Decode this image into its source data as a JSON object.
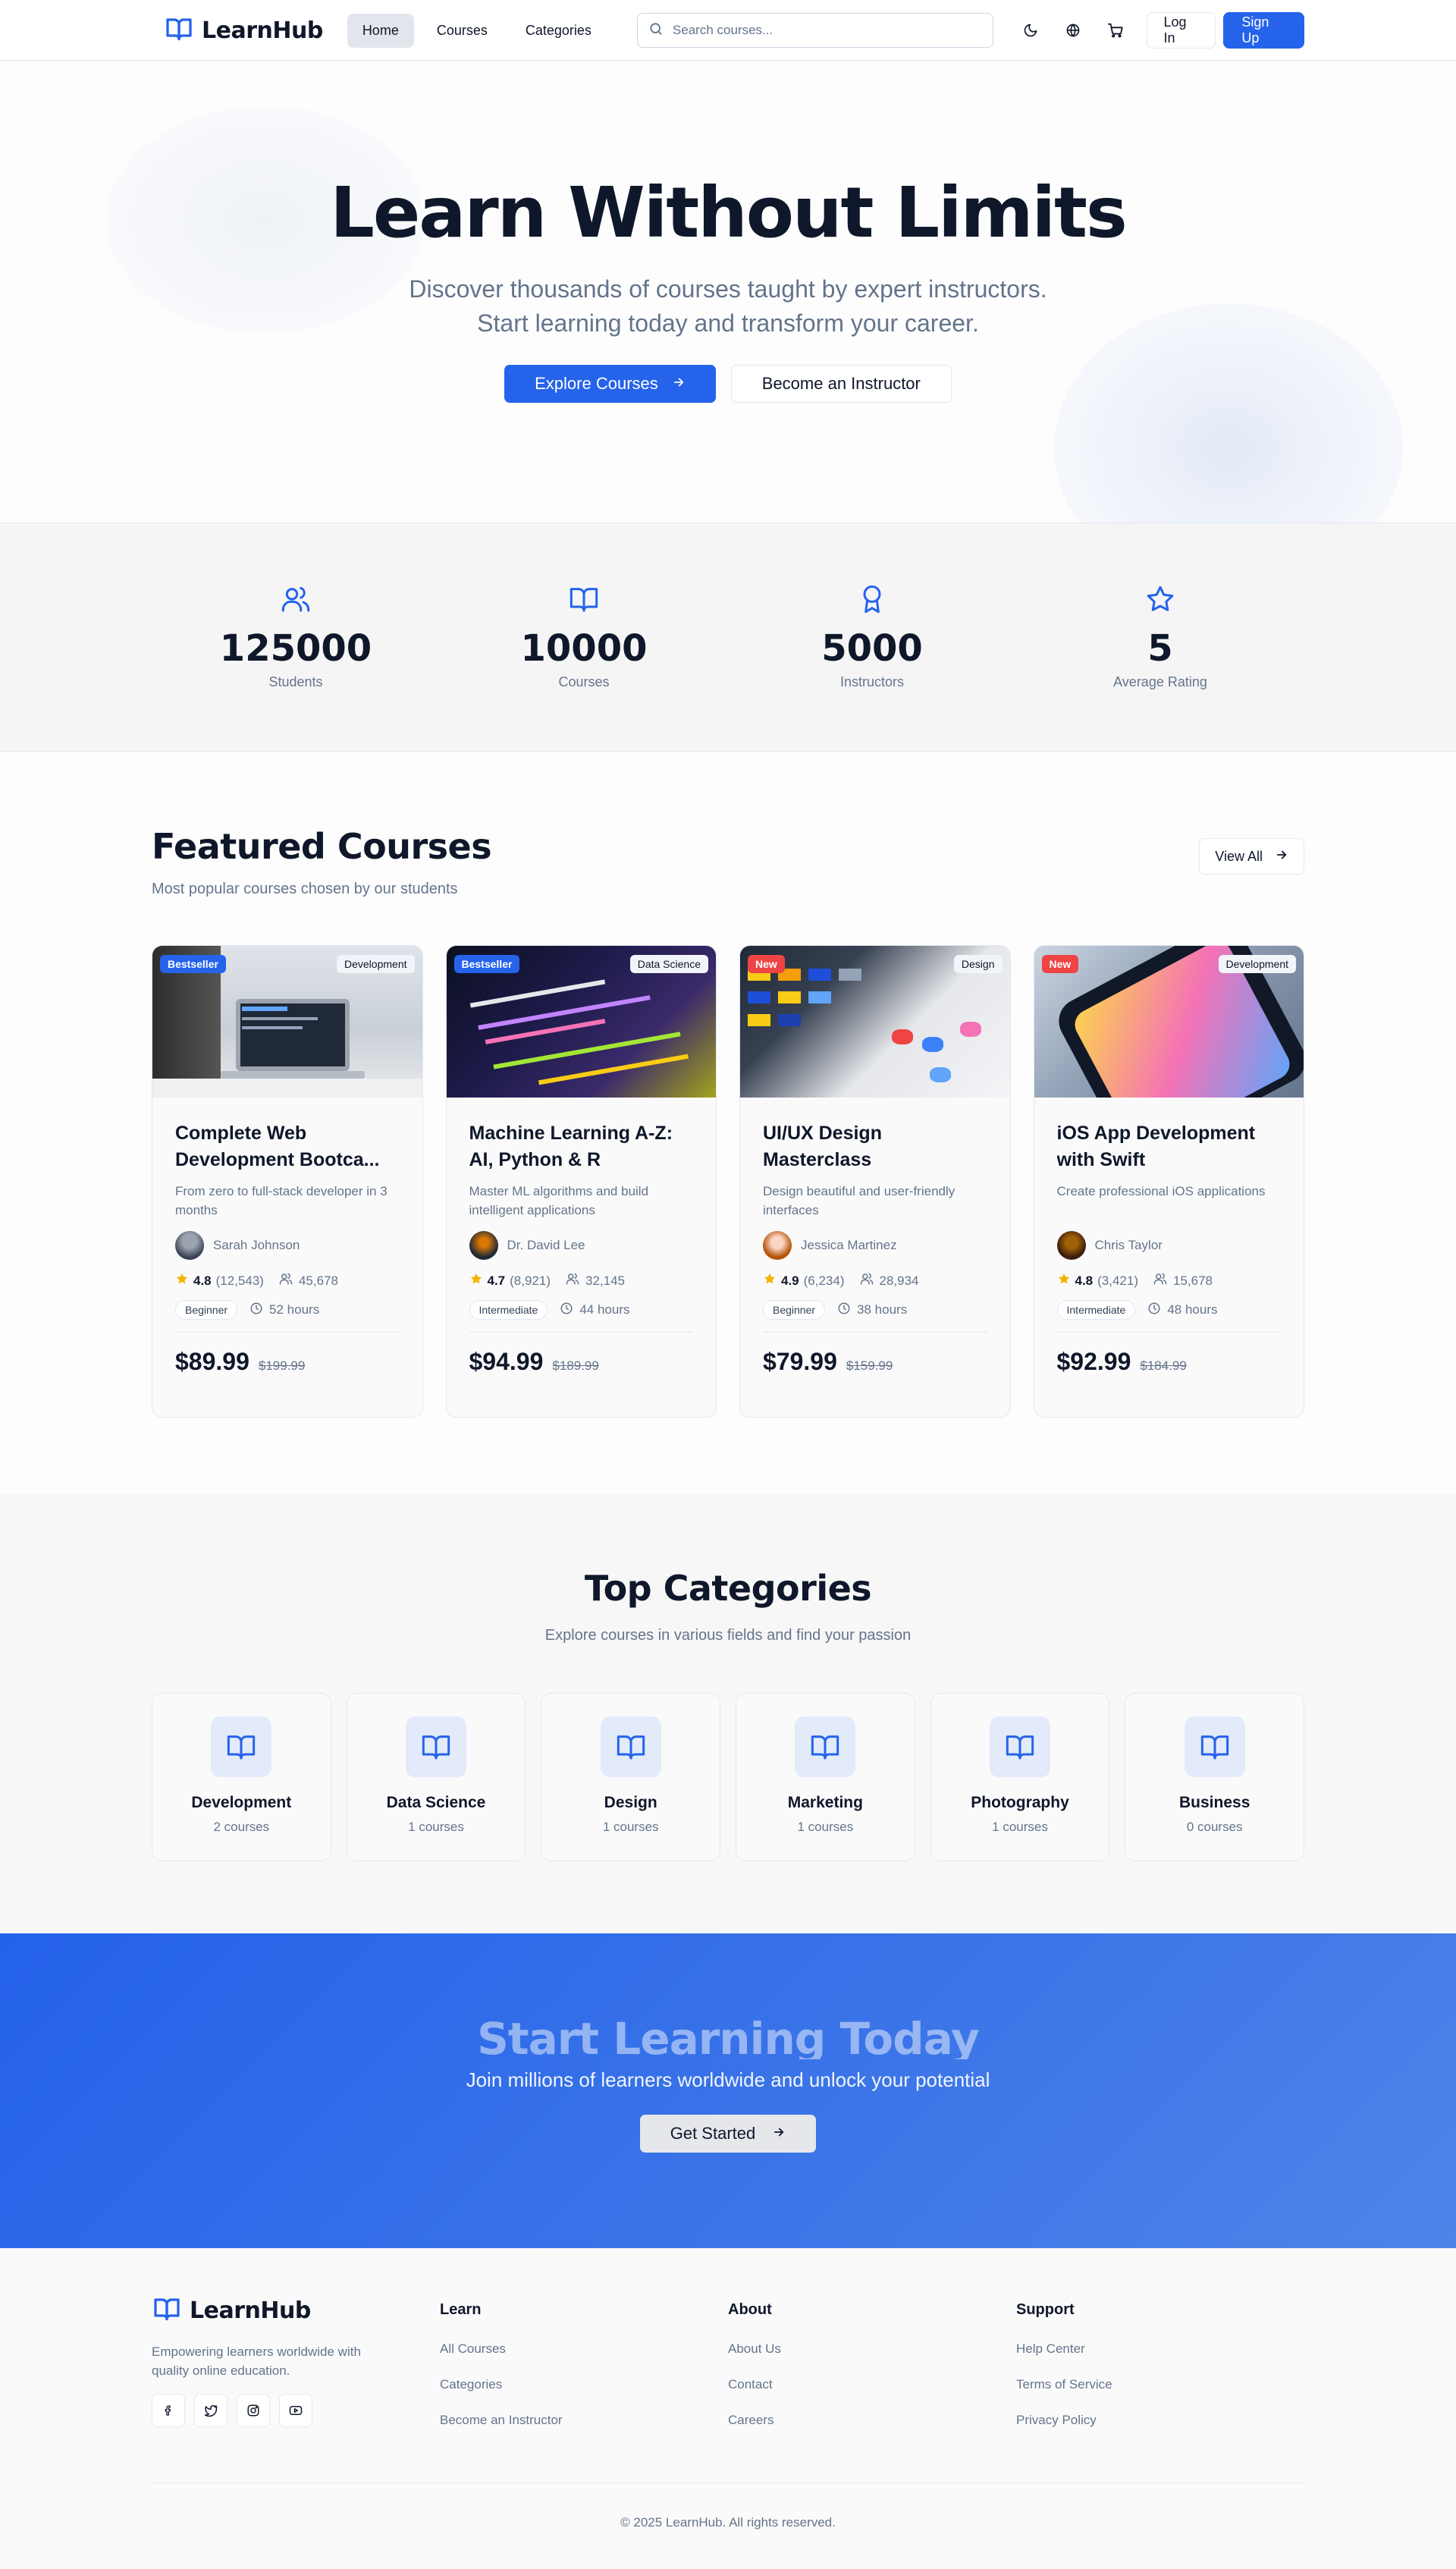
{
  "nav": {
    "brand": "LearnHub",
    "links": [
      {
        "label": "Home",
        "active": true
      },
      {
        "label": "Courses"
      },
      {
        "label": "Categories"
      }
    ],
    "search_placeholder": "Search courses...",
    "icons": [
      "moon-icon",
      "globe-icon",
      "cart-icon"
    ],
    "login_label": "Log In",
    "signup_label": "Sign Up"
  },
  "hero": {
    "title": "Learn Without Limits",
    "subtitle": "Discover thousands of courses taught by expert instructors. Start learning today and transform your career.",
    "primary_cta": "Explore Courses",
    "secondary_cta": "Become an Instructor"
  },
  "stats": [
    {
      "icon": "users-icon",
      "value": "125000",
      "label": "Students"
    },
    {
      "icon": "book-open-icon",
      "value": "10000",
      "label": "Courses"
    },
    {
      "icon": "award-icon",
      "value": "5000",
      "label": "Instructors"
    },
    {
      "icon": "star-icon",
      "value": "5",
      "label": "Average Rating"
    }
  ],
  "featured": {
    "title": "Featured Courses",
    "subtitle": "Most popular courses chosen by our students",
    "view_all": "View All",
    "courses": [
      {
        "badge": "Bestseller",
        "badge_color": "#2563eb",
        "category": "Development",
        "title": "Complete Web Development Bootca...",
        "description": "From zero to full-stack developer in 3 months",
        "instructor": "Sarah Johnson",
        "rating": "4.8",
        "reviews": "(12,543)",
        "students": "45,678",
        "level": "Beginner",
        "duration": "52 hours",
        "price": "$89.99",
        "original_price": "$199.99"
      },
      {
        "badge": "Bestseller",
        "badge_color": "#2563eb",
        "category": "Data Science",
        "title": "Machine Learning A-Z: AI, Python & R",
        "description": "Master ML algorithms and build intelligent applications",
        "instructor": "Dr. David Lee",
        "rating": "4.7",
        "reviews": "(8,921)",
        "students": "32,145",
        "level": "Intermediate",
        "duration": "44 hours",
        "price": "$94.99",
        "original_price": "$189.99"
      },
      {
        "badge": "New",
        "badge_color": "#ef4444",
        "category": "Design",
        "title": "UI/UX Design Masterclass",
        "description": "Design beautiful and user-friendly interfaces",
        "instructor": "Jessica Martinez",
        "rating": "4.9",
        "reviews": "(6,234)",
        "students": "28,934",
        "level": "Beginner",
        "duration": "38 hours",
        "price": "$79.99",
        "original_price": "$159.99"
      },
      {
        "badge": "New",
        "badge_color": "#ef4444",
        "category": "Development",
        "title": "iOS App Development with Swift",
        "description": "Create professional iOS applications",
        "instructor": "Chris Taylor",
        "rating": "4.8",
        "reviews": "(3,421)",
        "students": "15,678",
        "level": "Intermediate",
        "duration": "48 hours",
        "price": "$92.99",
        "original_price": "$184.99"
      }
    ]
  },
  "categories": {
    "title": "Top Categories",
    "subtitle": "Explore courses in various fields and find your passion",
    "items": [
      {
        "name": "Development",
        "count": "2 courses"
      },
      {
        "name": "Data Science",
        "count": "1 courses"
      },
      {
        "name": "Design",
        "count": "1 courses"
      },
      {
        "name": "Marketing",
        "count": "1 courses"
      },
      {
        "name": "Photography",
        "count": "1 courses"
      },
      {
        "name": "Business",
        "count": "0 courses"
      }
    ]
  },
  "cta": {
    "title": "Start Learning Today",
    "subtitle": "Join millions of learners worldwide and unlock your potential",
    "button": "Get Started"
  },
  "footer": {
    "brand": "LearnHub",
    "description": "Empowering learners worldwide with quality online education.",
    "socials": [
      "facebook-icon",
      "twitter-icon",
      "instagram-icon",
      "youtube-icon"
    ],
    "columns": [
      {
        "heading": "Learn",
        "links": [
          "All Courses",
          "Categories",
          "Become an Instructor"
        ]
      },
      {
        "heading": "About",
        "links": [
          "About Us",
          "Contact",
          "Careers"
        ]
      },
      {
        "heading": "Support",
        "links": [
          "Help Center",
          "Terms of Service",
          "Privacy Policy"
        ]
      }
    ],
    "copyright": "© 2025 LearnHub. All rights reserved."
  },
  "colors": {
    "primary": "#2563eb",
    "star": "#f5b301",
    "new_badge": "#ef4444"
  }
}
